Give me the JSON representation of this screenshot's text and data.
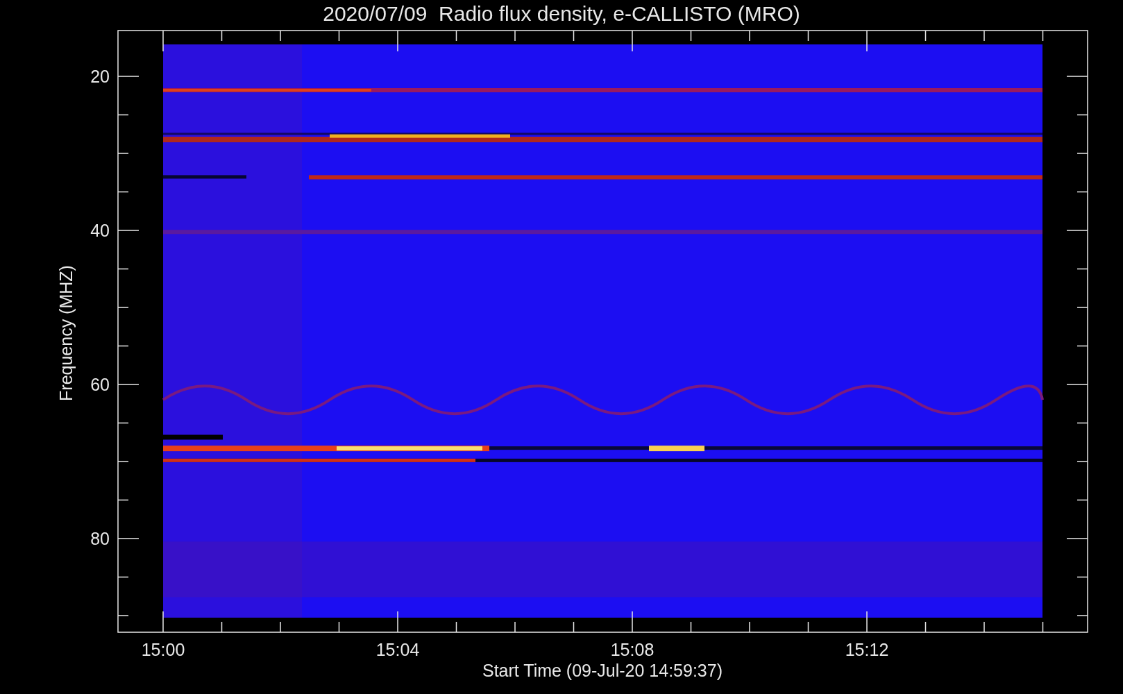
{
  "title": "2020/07/09  Radio flux density, e-CALLISTO (MRO)",
  "plot": {
    "ylabel": "Frequency (MHZ)",
    "xlabel": "Start Time (09-Jul-20 14:59:37)",
    "yticks": [
      "20",
      "40",
      "60",
      "80"
    ],
    "xticks": [
      "15:00",
      "15:04",
      "15:08",
      "15:12"
    ]
  }
}
